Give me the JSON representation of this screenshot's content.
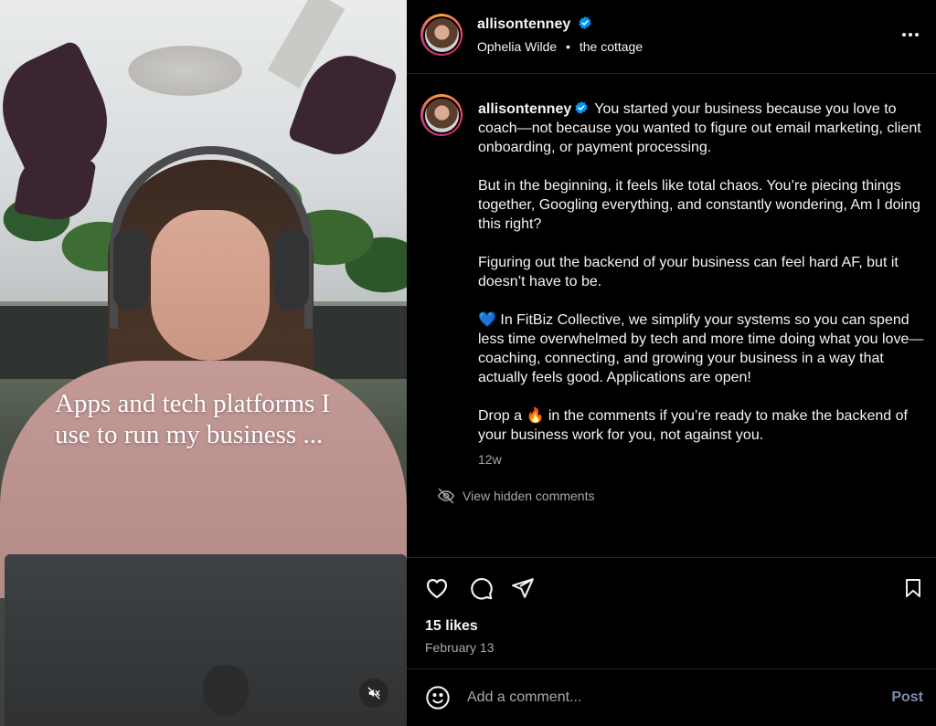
{
  "media": {
    "caption_line1": "Apps and tech platforms I",
    "caption_line2": "use to run my business ...",
    "mute_icon": "muted-speaker-icon"
  },
  "post": {
    "username": "allisontenney",
    "verified": true,
    "audio_artist": "Ophelia Wilde",
    "location": "the cottage",
    "separator": "•",
    "more_icon": "ellipsis-icon",
    "body": {
      "p1": "You started your business because you love to coach—not because you wanted to figure out email marketing, client onboarding, or payment processing.",
      "p2": "But in the beginning, it feels like total chaos. You’re piecing things together, Googling everything, and constantly wondering, Am I doing this right?",
      "p3": "Figuring out the backend of your business can feel hard AF, but it doesn’t have to be.",
      "p4": "💙 In FitBiz Collective, we simplify your systems so you can spend less time overwhelmed by tech and more time doing what you love—coaching, connecting, and growing your business in a way that actually feels good. Applications are open!",
      "p5": "Drop a 🔥 in the comments if you’re ready to make the backend of your business work for you, not against you."
    },
    "time_ago": "12w",
    "hidden_comments_label": "View hidden comments",
    "likes": "15 likes",
    "date": "February 13",
    "comment_placeholder": "Add a comment...",
    "post_label": "Post"
  },
  "colors": {
    "background": "#000000",
    "text": "#f5f5f5",
    "secondary_text": "#a8a8a8",
    "verified_blue": "#0095f6",
    "post_button": "#7d8da8",
    "divider": "#262626"
  }
}
